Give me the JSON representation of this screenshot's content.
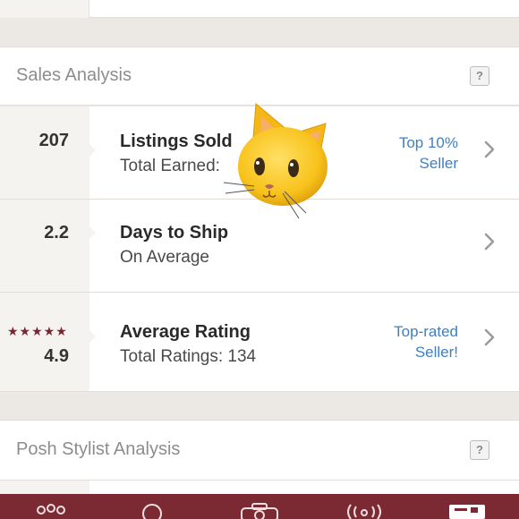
{
  "sales_section": {
    "title": "Sales Analysis",
    "help_label": "?"
  },
  "rows": [
    {
      "value": "207",
      "title": "Listings Sold",
      "subtitle": "Total Earned:",
      "badge_line1": "Top 10%",
      "badge_line2": "Seller"
    },
    {
      "value": "2.2",
      "title": "Days to Ship",
      "subtitle": "On Average"
    },
    {
      "stars": "★★★★★",
      "value": "4.9",
      "title": "Average Rating",
      "subtitle": "Total Ratings: 134",
      "badge_line1": "Top-rated",
      "badge_line2": "Seller!"
    }
  ],
  "stylist_section": {
    "title": "Posh Stylist Analysis",
    "help_label": "?"
  },
  "overlay": {
    "icon": "cat-face-emoji-icon"
  },
  "tab_bar": {
    "icons": [
      "community-icon",
      "search-icon",
      "camera-icon",
      "broadcast-icon",
      "account-icon"
    ]
  },
  "colors": {
    "accent_link": "#3f7fc2",
    "tab_bar": "#7b2a33",
    "star": "#7c2431"
  }
}
